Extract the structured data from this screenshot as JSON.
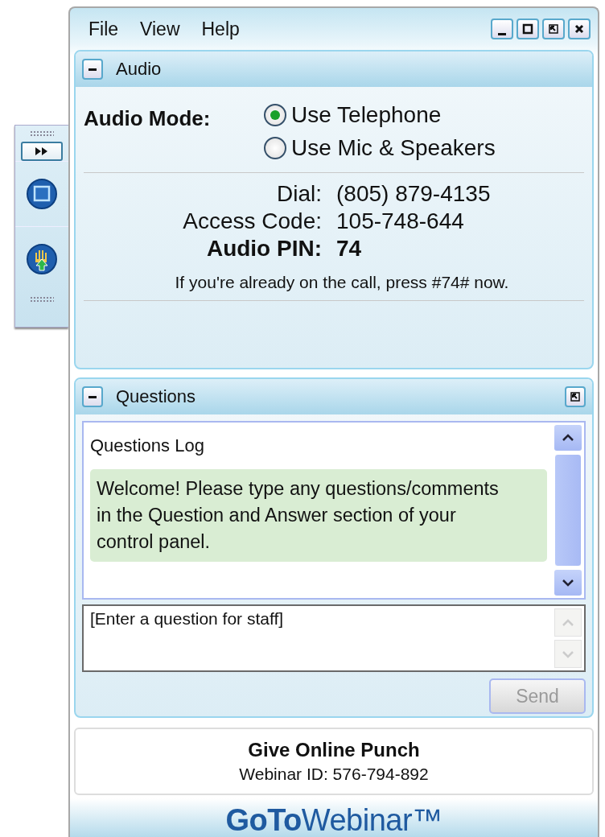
{
  "menu": [
    {
      "label": "File"
    },
    {
      "label": "View"
    },
    {
      "label": "Help"
    }
  ],
  "audio": {
    "title": "Audio",
    "expanded": true,
    "mode_label": "Audio Mode:",
    "options": [
      {
        "label": "Use Telephone",
        "selected": true
      },
      {
        "label": "Use Mic & Speakers",
        "selected": false
      }
    ],
    "details": [
      {
        "label": "Dial:",
        "value": "(805) 879-4135",
        "kind": "plain"
      },
      {
        "label": "Access Code:",
        "value": "105-748-644",
        "kind": "plain"
      },
      {
        "label": "Audio PIN:",
        "value": "74",
        "kind": "bold"
      }
    ],
    "note": "If you're already on the call, press #74# now."
  },
  "questions": {
    "title": "Questions",
    "expanded": true,
    "log_title": "Questions Log",
    "messages": [
      {
        "text": "Welcome! Please type any questions/comments in the Question and Answer section of your control panel."
      }
    ],
    "input": {
      "placeholder": "[Enter a question for staff]"
    },
    "send": {
      "label": "Send",
      "disabled": true
    }
  },
  "footer": {
    "webinar_name": "Give Online Punch",
    "webinar_id": "Webinar ID: 576-794-892",
    "logo": "**GoTo**Webinar™"
  }
}
